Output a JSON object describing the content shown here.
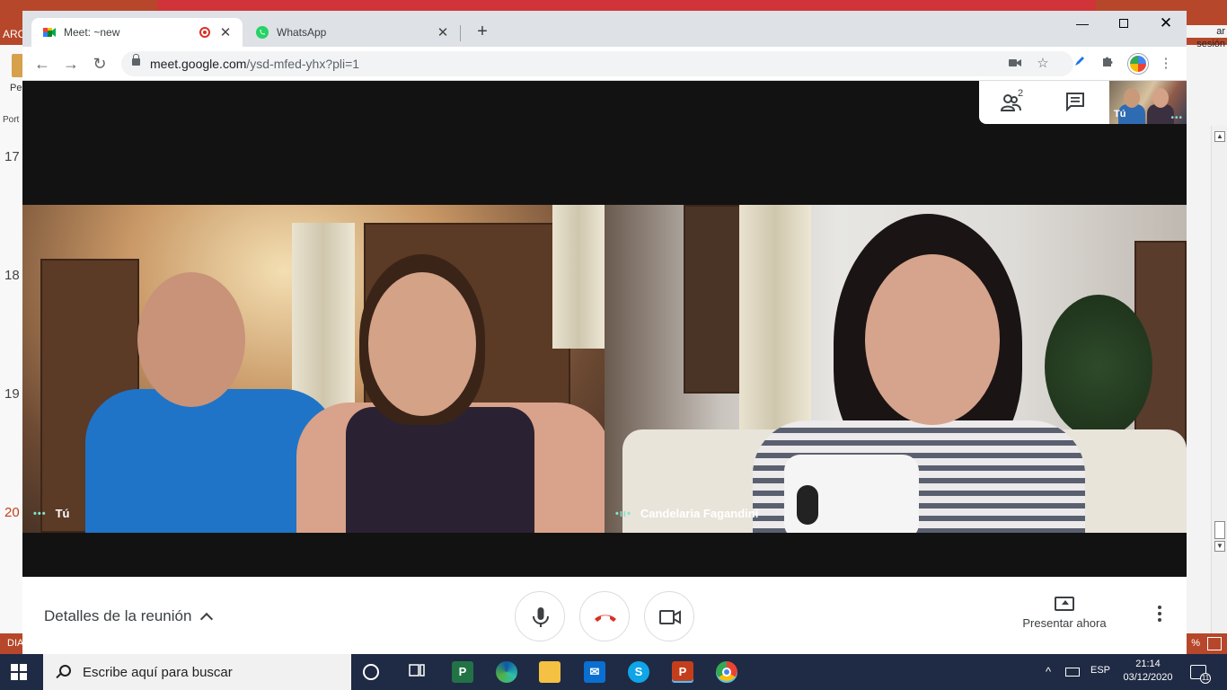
{
  "background_app": {
    "left_tab": "ARC",
    "left_label": "Pe",
    "left_col_label": "Port",
    "right_tab": "ar sesión",
    "slide_numbers": [
      "17",
      "18",
      "19",
      "20"
    ],
    "status_left": "DIA",
    "status_right": "%"
  },
  "browser": {
    "tabs": [
      {
        "title": "Meet: ~new",
        "icon": "google-meet-icon",
        "recording": true
      },
      {
        "title": "WhatsApp",
        "icon": "whatsapp-icon",
        "recording": false
      }
    ],
    "new_tab_label": "+",
    "url_host": "meet.google.com",
    "url_path": "/ysd-mfed-yhx?pli=1"
  },
  "meet": {
    "participants_count": "2",
    "self_thumb_label": "Tú",
    "tiles": [
      {
        "name": "Tú"
      },
      {
        "name": "Candelaria Fagandini"
      }
    ],
    "details_label": "Detalles de la reunión",
    "present_label": "Presentar ahora"
  },
  "taskbar": {
    "search_placeholder": "Escribe aquí para buscar",
    "language": "ESP",
    "time": "21:14",
    "date": "03/12/2020",
    "notifications": "11"
  },
  "colors": {
    "powerpoint": "#b7472a",
    "meet_bg": "#121212",
    "end_call": "#d93025",
    "taskbar": "#1f2a44"
  }
}
